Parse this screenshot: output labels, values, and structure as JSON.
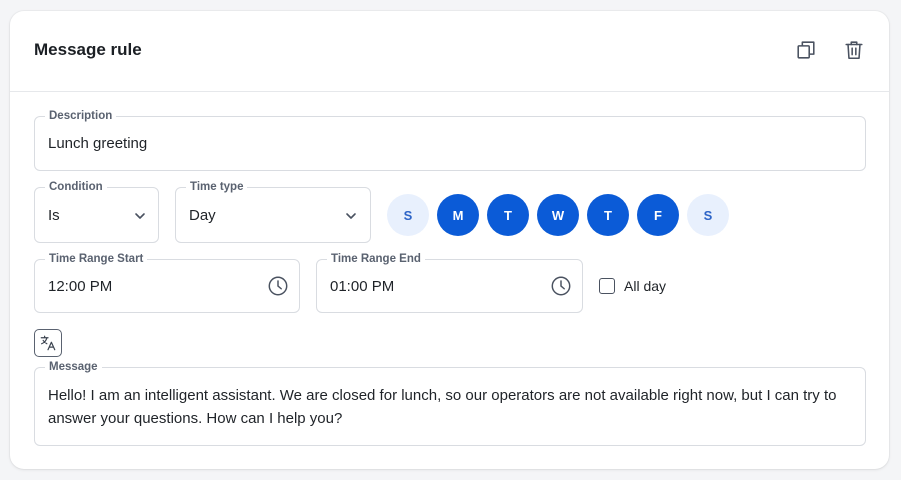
{
  "card": {
    "title": "Message rule",
    "actions": {
      "duplicate_icon": "copy-icon",
      "delete_icon": "trash-icon"
    }
  },
  "description": {
    "label": "Description",
    "value": "Lunch greeting"
  },
  "condition": {
    "label": "Condition",
    "value": "Is"
  },
  "time_type": {
    "label": "Time type",
    "value": "Day"
  },
  "days": [
    {
      "letter": "S",
      "selected": false
    },
    {
      "letter": "M",
      "selected": true
    },
    {
      "letter": "T",
      "selected": true
    },
    {
      "letter": "W",
      "selected": true
    },
    {
      "letter": "T",
      "selected": true
    },
    {
      "letter": "F",
      "selected": true
    },
    {
      "letter": "S",
      "selected": false
    }
  ],
  "time_range_start": {
    "label": "Time Range Start",
    "value": "12:00 PM"
  },
  "time_range_end": {
    "label": "Time Range End",
    "value": "01:00 PM"
  },
  "all_day": {
    "label": "All day",
    "checked": false
  },
  "message": {
    "label": "Message",
    "value": "Hello! I am an intelligent assistant. We are closed for lunch, so our operators are not available right now, but I can try to answer your questions. How can I help you?"
  },
  "colors": {
    "accent": "#0b5bd7",
    "day_off_bg": "#e8f0fd",
    "border": "#d9dce1"
  }
}
